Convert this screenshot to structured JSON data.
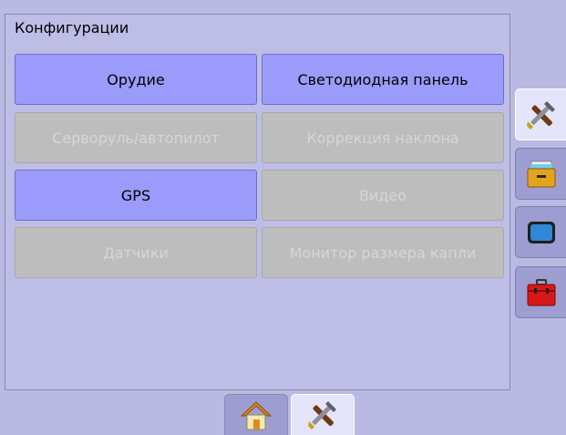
{
  "panel": {
    "title": "Конфигурации"
  },
  "buttons": [
    {
      "label": "Орудие",
      "enabled": true
    },
    {
      "label": "Светодиодная панель",
      "enabled": true
    },
    {
      "label": "Серворуль/автопилот",
      "enabled": false
    },
    {
      "label": "Коррекция наклона",
      "enabled": false
    },
    {
      "label": "GPS",
      "enabled": true
    },
    {
      "label": "Видео",
      "enabled": false
    },
    {
      "label": "Датчики",
      "enabled": false
    },
    {
      "label": "Монитор размера капли",
      "enabled": false
    }
  ],
  "side_tabs": [
    {
      "icon": "tools-icon",
      "active": true
    },
    {
      "icon": "file-drawer-icon",
      "active": false
    },
    {
      "icon": "screen-icon",
      "active": false
    },
    {
      "icon": "toolbox-icon",
      "active": false
    }
  ],
  "bottom_tabs": [
    {
      "icon": "home-icon",
      "active": false
    },
    {
      "icon": "tools-icon",
      "active": true
    }
  ],
  "colors": {
    "background": "#b9b9e3",
    "button_enabled": "#9b9bfb",
    "button_disabled": "#bdbdbd",
    "tab_active": "#e4e4fb",
    "tab_inactive": "#9d9dd1"
  }
}
